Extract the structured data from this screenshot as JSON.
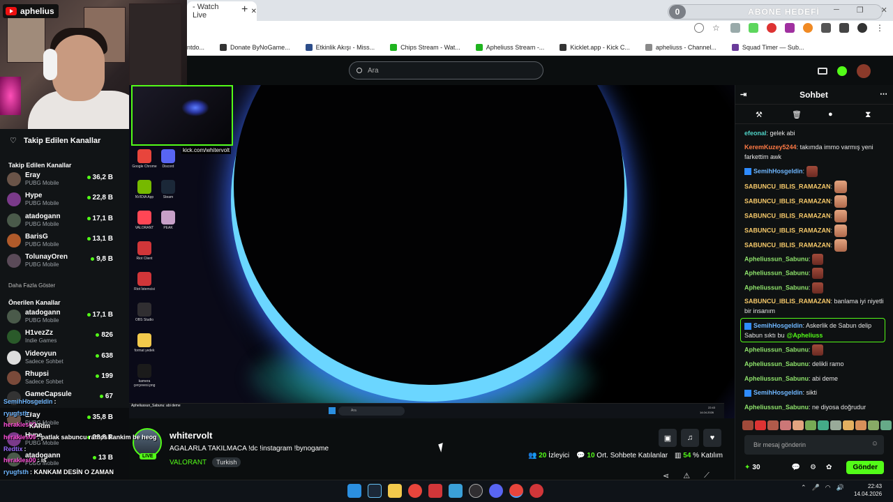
{
  "webcam": {
    "channel": "aphelius"
  },
  "browser": {
    "tab_title": "- Watch Live",
    "tab_close": "✕",
    "new_tab": "+",
    "bookmarks": [
      {
        "label": "ntdo...",
        "color": "#777"
      },
      {
        "label": "Donate ByNoGame...",
        "color": "#333"
      },
      {
        "label": "Etkinlik Akışı - Miss...",
        "color": "#2c4d8a"
      },
      {
        "label": "Chips Stream - Wat...",
        "color": "#1fb41f"
      },
      {
        "label": "Apheliuss Stream -...",
        "color": "#1fb41f"
      },
      {
        "label": "Kicklet.app - Kick C...",
        "color": "#333"
      },
      {
        "label": "apheliuss - Channel...",
        "color": "#8a8a8a"
      },
      {
        "label": "Squad Timer — Sub...",
        "color": "#6a3b9a"
      }
    ]
  },
  "overlay": {
    "goal_count": "0",
    "goal_label": "ABONE HEDEFİ"
  },
  "kick": {
    "search_placeholder": "Ara",
    "pip_url": "kick.com/whitervolt"
  },
  "sidebar": {
    "header": "Takip Edilen Kanallar",
    "followed_title": "Takip Edilen Kanallar",
    "followed": [
      {
        "name": "Eray",
        "game": "PUBG Mobile",
        "viewers": "36,2 B"
      },
      {
        "name": "Hype",
        "game": "PUBG Mobile",
        "viewers": "22,8 B"
      },
      {
        "name": "atadogann",
        "game": "PUBG Mobile",
        "viewers": "17,1 B"
      },
      {
        "name": "BarisG",
        "game": "PUBG Mobile",
        "viewers": "13,1 B"
      },
      {
        "name": "TolunayOren",
        "game": "PUBG Mobile",
        "viewers": "9,8 B"
      }
    ],
    "show_more": "Daha Fazla Göster",
    "recommended_title": "Önerilen Kanallar",
    "recommended": [
      {
        "name": "atadogann",
        "game": "PUBG Mobile",
        "viewers": "17,1 B"
      },
      {
        "name": "H1vezZz",
        "game": "Indie Games",
        "viewers": "826"
      },
      {
        "name": "Videoyun",
        "game": "Sadece Sohbet",
        "viewers": "638"
      },
      {
        "name": "Rhupsi",
        "game": "Sadece Sohbet",
        "viewers": "199"
      },
      {
        "name": "GameCapsule",
        "game": "Replaced",
        "viewers": "67"
      },
      {
        "name": "Eray",
        "game": "PUBG Mobile",
        "viewers": "35,8 B"
      },
      {
        "name": "Hype",
        "game": "PUBG Mobile",
        "viewers": "22,8 B"
      },
      {
        "name": "atadogann",
        "game": "PUBG Mobile",
        "viewers": "13 B"
      }
    ]
  },
  "desktop": {
    "icons": [
      {
        "label": "Google Chrome",
        "color": "#e8453c"
      },
      {
        "label": "Discord",
        "color": "#5865f2"
      },
      {
        "label": "NVIDIA App",
        "color": "#76b900"
      },
      {
        "label": "Steam",
        "color": "#1b2838"
      },
      {
        "label": "VALORANT",
        "color": "#ff4655"
      },
      {
        "label": "PEAK",
        "color": "#c7a0c8"
      },
      {
        "label": "Riot Client",
        "color": "#d13639"
      },
      {
        "label": "Riot İstemcisi",
        "color": "#d13639"
      },
      {
        "label": "OBS Studio",
        "color": "#302e31"
      },
      {
        "label": "format yedek",
        "color": "#f2c94c"
      },
      {
        "label": "kamera çerçevesi.png",
        "color": "#1b1b1b"
      }
    ],
    "inner_chat": "Apheliussun_Sabunu: abi deme",
    "inner_search": "Ara",
    "inner_time": "22:43",
    "inner_date": "14.04.2026"
  },
  "stream": {
    "name": "whitervolt",
    "live": "LIVE",
    "title": "AGALARLA TAKILMACA !dc !instagram !bynogame",
    "category": "VALORANT",
    "language": "Turkish",
    "viewers": "20",
    "viewers_label": "İzleyici",
    "chatters": "10",
    "chatters_label": "Ort. Sohbete Katılanlar",
    "participation": "54",
    "participation_label": "% Katılım"
  },
  "chat": {
    "title": "Sohbet",
    "messages": [
      {
        "user": "efeonal",
        "color": "#4fd1c5",
        "text": "gelek abi"
      },
      {
        "user": "KeremKuzey5244",
        "color": "#ff7a45",
        "text": "takımda immo varmış yeni farkettim awk"
      },
      {
        "user": "SemihHosgeldin",
        "color": "#6fb7ff",
        "text": ""
      },
      {
        "user": "SABUNCU_IBLIS_RAMAZAN",
        "color": "#f6c96a",
        "text": ""
      },
      {
        "user": "SABUNCU_IBLIS_RAMAZAN",
        "color": "#f6c96a",
        "text": ""
      },
      {
        "user": "SABUNCU_IBLIS_RAMAZAN",
        "color": "#f6c96a",
        "text": ""
      },
      {
        "user": "SABUNCU_IBLIS_RAMAZAN",
        "color": "#f6c96a",
        "text": ""
      },
      {
        "user": "SABUNCU_IBLIS_RAMAZAN",
        "color": "#f6c96a",
        "text": ""
      },
      {
        "user": "Apheliussun_Sabunu",
        "color": "#8ee26b",
        "text": ""
      },
      {
        "user": "Apheliussun_Sabunu",
        "color": "#8ee26b",
        "text": ""
      },
      {
        "user": "Apheliussun_Sabunu",
        "color": "#8ee26b",
        "text": ""
      },
      {
        "user": "SABUNCU_IBLIS_RAMAZAN",
        "color": "#f6c96a",
        "text": "banlama iyi niyetli bir insanım"
      },
      {
        "user": "SemihHosgeldin",
        "color": "#6fb7ff",
        "text": "Askerlik de Sabun delip Sabun sıktı bu",
        "mention": "@Apheliuss"
      },
      {
        "user": "Apheliussun_Sabunu",
        "color": "#8ee26b",
        "text": ""
      },
      {
        "user": "Apheliussun_Sabunu",
        "color": "#8ee26b",
        "text": "delikli ramo"
      },
      {
        "user": "Apheliussun_Sabunu",
        "color": "#8ee26b",
        "text": "abi deme"
      },
      {
        "user": "SemihHosgeldin",
        "color": "#6fb7ff",
        "text": "sikti"
      },
      {
        "user": "Apheliussun_Sabunu",
        "color": "#8ee26b",
        "text": "ne diyosa doğrudur"
      }
    ],
    "input_placeholder": "Bir mesaj gönderin",
    "points": "30",
    "send": "Gönder"
  },
  "overlay_chat": [
    {
      "user": "SemihHosgeldin",
      "text": ":",
      "color": "#6fb7ff"
    },
    {
      "user": "ryugfsth",
      "text": ":",
      "color": "#6fb7ff"
    },
    {
      "user": "herakles00",
      "text": ":",
      "color": "#ff4fd8"
    },
    {
      "user": "",
      "text": "KARİm",
      "color": "#fff"
    },
    {
      "user": "herakles00",
      "text": ": patlak sabuncu ramos kankim be heog",
      "color": "#ff4fd8"
    },
    {
      "user": "Redtix",
      "text": ":",
      "color": "#9b6bff"
    },
    {
      "user": "herakles00",
      "text": ": is",
      "color": "#ff4fd8"
    },
    {
      "user": "ryugfsth",
      "text": ": KANKAM DESİN O ZAMAN",
      "color": "#6fb7ff"
    },
    {
      "user": "Redtix",
      "text": ": bu gay bu arada",
      "color": "#9b6bff"
    },
    {
      "user": "ryugfsth",
      "text": ":",
      "color": "#6fb7ff"
    }
  ],
  "taskbar": {
    "time": "22:43",
    "date": "14.04.2026"
  }
}
